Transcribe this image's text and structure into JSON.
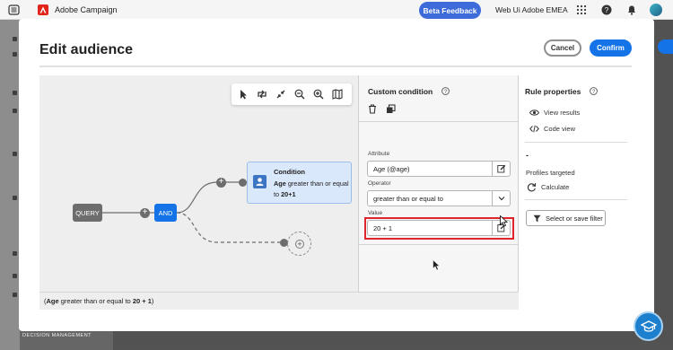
{
  "topbar": {
    "app_title": "Adobe Campaign",
    "beta_label": "Beta Feedback",
    "org_name": "Web Ui Adobe EMEA"
  },
  "sidebar": {
    "section_label": "DECISION MANAGEMENT"
  },
  "dialog": {
    "title": "Edit audience",
    "cancel_label": "Cancel",
    "confirm_label": "Confirm"
  },
  "canvas": {
    "query_label": "QUERY",
    "and_label": "AND",
    "condition": {
      "title": "Condition",
      "attr": "Age",
      "text": " greater than or equal to ",
      "value": "20+1"
    },
    "summary": {
      "open": "(",
      "attr": "Age",
      "text": " greater than or equal to ",
      "value": "20 + 1",
      "close": ")"
    }
  },
  "custom_condition": {
    "title": "Custom condition",
    "attribute_label": "Attribute",
    "attribute_value": "Age (@age)",
    "operator_label": "Operator",
    "operator_value": "greater than or equal to",
    "value_label": "Value",
    "value_value": "20 + 1"
  },
  "rule_properties": {
    "title": "Rule properties",
    "view_results": "View results",
    "code_view": "Code view",
    "count_value": "-",
    "profiles_targeted": "Profiles targeted",
    "calculate": "Calculate",
    "select_filter": "Select or save filter"
  },
  "colors": {
    "accent": "#1473e6",
    "beta": "#3d6bd9",
    "highlight": "#e0252a",
    "condition_bg": "#dae8fb"
  }
}
